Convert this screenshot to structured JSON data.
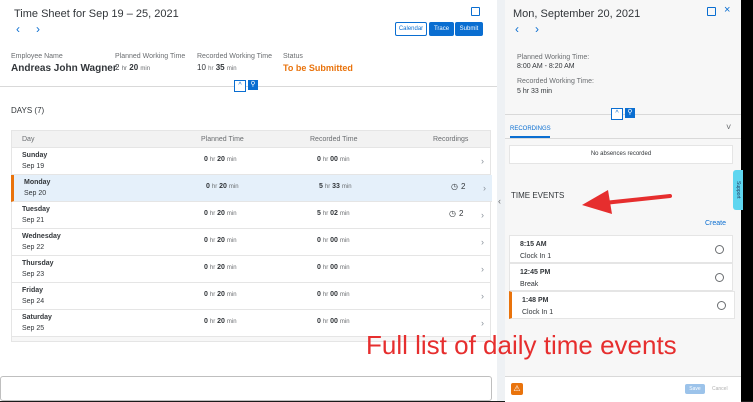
{
  "timesheet": {
    "title": "Time Sheet for Sep 19 – 25, 2021",
    "nav_prev": "‹",
    "nav_next": "›",
    "buttons": {
      "calendar": "Calendar",
      "trace": "Trace",
      "submit": "Submit"
    },
    "employee": {
      "label": "Employee Name",
      "value": "Andreas John Wagner"
    },
    "planned": {
      "label": "Planned Working Time",
      "hr": "2",
      "hr_unit": "hr",
      "min": "20",
      "min_unit": "min"
    },
    "recorded": {
      "label": "Recorded Working Time",
      "hr": "10",
      "hr_unit": "hr",
      "min": "35",
      "min_unit": "min"
    },
    "status": {
      "label": "Status",
      "value": "To be Submitted"
    },
    "days_title": "DAYS (7)",
    "columns": {
      "day": "Day",
      "planned": "Planned Time",
      "recorded": "Recorded Time",
      "recordings": "Recordings"
    },
    "days": [
      {
        "name": "Sunday",
        "date": "Sep 19",
        "ph": "0",
        "pm": "20",
        "rh": "0",
        "rm": "00",
        "rec": ""
      },
      {
        "name": "Monday",
        "date": "Sep 20",
        "ph": "0",
        "pm": "20",
        "rh": "5",
        "rm": "33",
        "rec": "2"
      },
      {
        "name": "Tuesday",
        "date": "Sep 21",
        "ph": "0",
        "pm": "20",
        "rh": "5",
        "rm": "02",
        "rec": "2"
      },
      {
        "name": "Wednesday",
        "date": "Sep 22",
        "ph": "0",
        "pm": "20",
        "rh": "0",
        "rm": "00",
        "rec": ""
      },
      {
        "name": "Thursday",
        "date": "Sep 23",
        "ph": "0",
        "pm": "20",
        "rh": "0",
        "rm": "00",
        "rec": ""
      },
      {
        "name": "Friday",
        "date": "Sep 24",
        "ph": "0",
        "pm": "20",
        "rh": "0",
        "rm": "00",
        "rec": ""
      },
      {
        "name": "Saturday",
        "date": "Sep 25",
        "ph": "0",
        "pm": "20",
        "rh": "0",
        "rm": "00",
        "rec": ""
      }
    ],
    "units": {
      "hr": "hr",
      "min": "min"
    }
  },
  "day_detail": {
    "title": "Mon, September 20, 2021",
    "planned_label": "Planned Working Time:",
    "planned_value": "8:00 AM - 8:20 AM",
    "recorded_label": "Recorded Working Time:",
    "recorded_value": "5 hr 33 min",
    "recordings_tab": "RECORDINGS",
    "no_absences": "No absences recorded",
    "time_events_title": "TIME EVENTS",
    "create_link": "Create",
    "events": [
      {
        "time": "8:15 AM",
        "type": "Clock In 1"
      },
      {
        "time": "12:45 PM",
        "type": "Break"
      },
      {
        "time": "1:48 PM",
        "type": "Clock In 1"
      }
    ],
    "save": "Save",
    "cancel": "Cancel"
  },
  "support_tab": "Support",
  "annotation": "Full list of daily time events",
  "colors": {
    "accent": "#0a6ed1",
    "status": "#e9730c",
    "arrow": "#e62e2e"
  }
}
